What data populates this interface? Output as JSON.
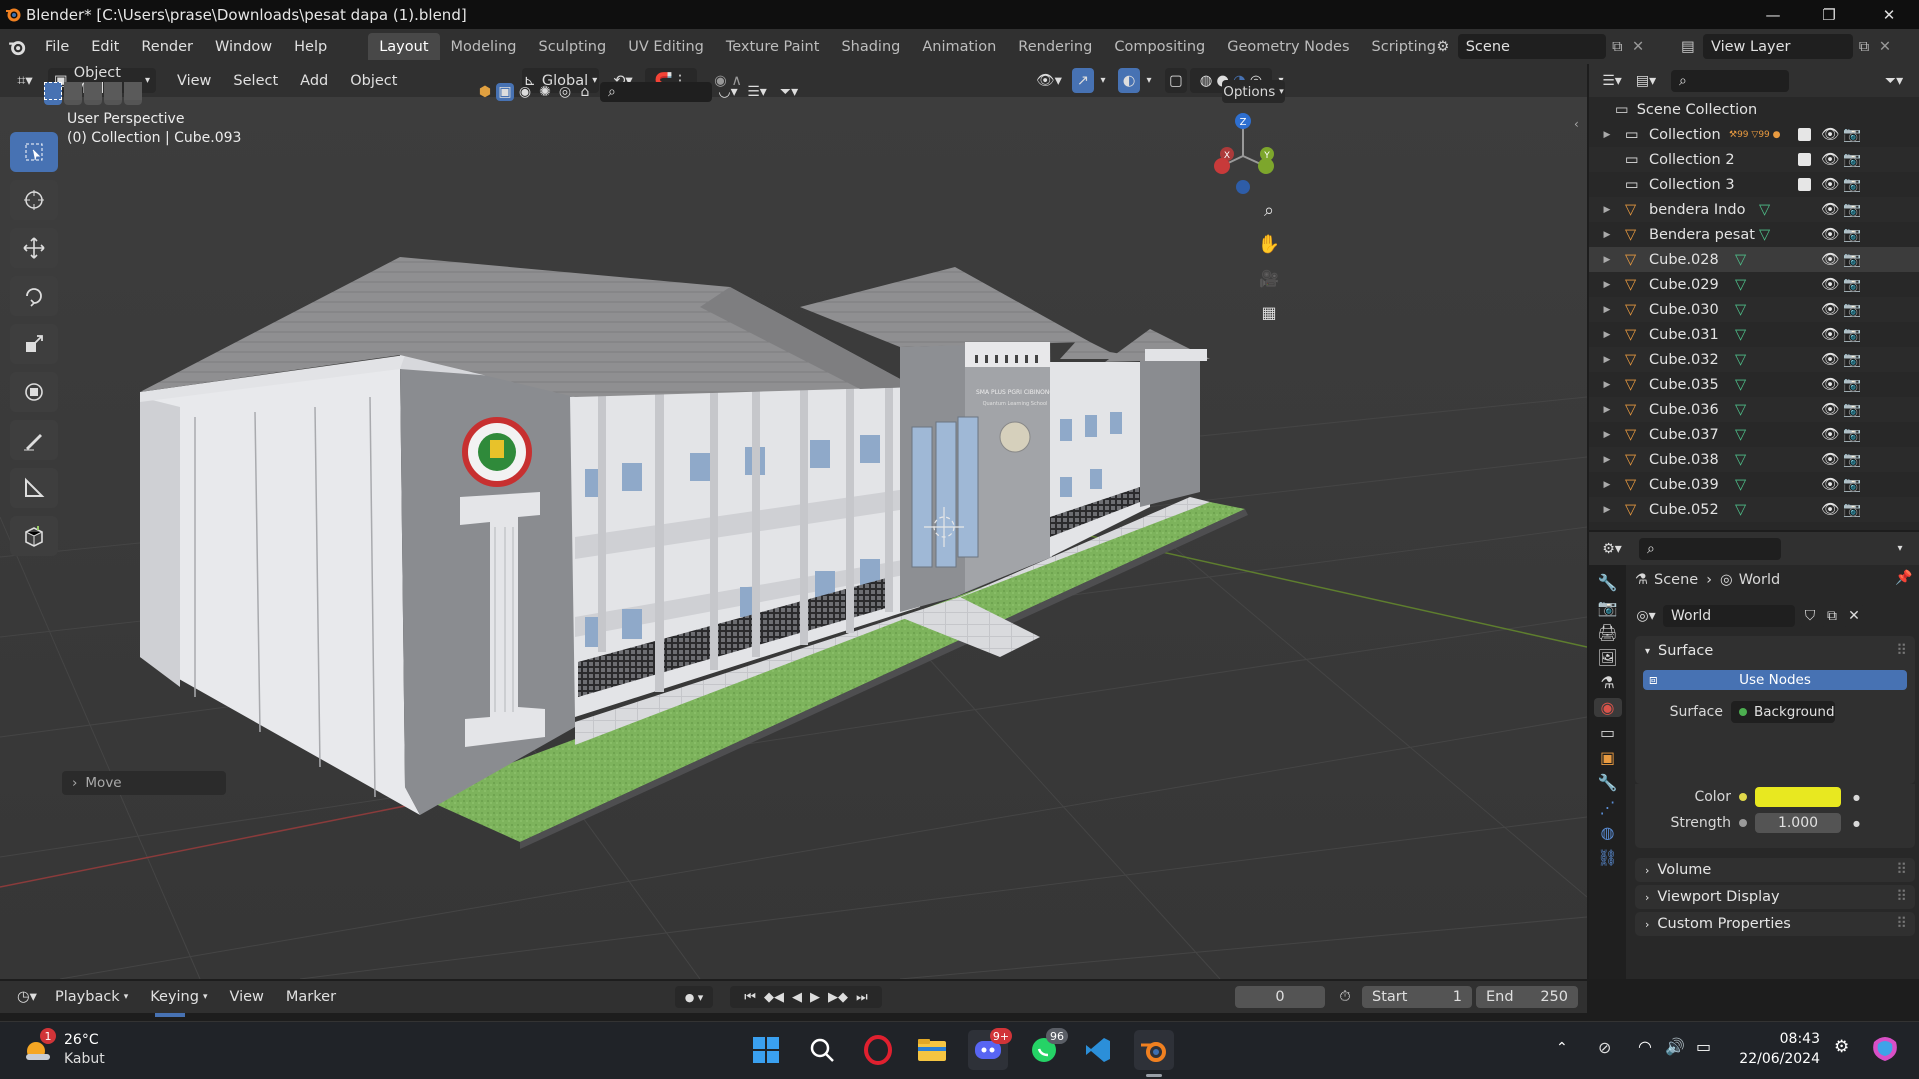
{
  "window": {
    "title": "Blender* [C:\\Users\\prase\\Downloads\\pesat dapa (1).blend]"
  },
  "menu": [
    "File",
    "Edit",
    "Render",
    "Window",
    "Help"
  ],
  "workspaces": [
    "Layout",
    "Modeling",
    "Sculpting",
    "UV Editing",
    "Texture Paint",
    "Shading",
    "Animation",
    "Rendering",
    "Compositing",
    "Geometry Nodes",
    "Scripting"
  ],
  "active_workspace": "Layout",
  "scene": {
    "name": "Scene",
    "view_layer": "View Layer"
  },
  "viewport_header": {
    "mode": "Object Mode",
    "menus": [
      "View",
      "Select",
      "Add",
      "Object"
    ],
    "transform_orientation": "Global",
    "options": "Options"
  },
  "viewport": {
    "perspective": "User Perspective",
    "collection_info": "(0) Collection | Cube.093",
    "last_op": "Move",
    "gizmo_axes": [
      "X",
      "Y",
      "Z"
    ]
  },
  "building": {
    "sign_line1": "SMA PLUS PGRI CIBINONG",
    "sign_line2": "Quantum Learning School"
  },
  "outliner": {
    "root": "Scene Collection",
    "collection_badges": [
      "99",
      "99"
    ],
    "items": [
      {
        "name": "Collection",
        "type": "collection"
      },
      {
        "name": "Collection 2",
        "type": "collection"
      },
      {
        "name": "Collection 3",
        "type": "collection"
      },
      {
        "name": "bendera Indo",
        "type": "mesh"
      },
      {
        "name": "Bendera pesat",
        "type": "mesh"
      },
      {
        "name": "Cube.028",
        "type": "mesh"
      },
      {
        "name": "Cube.029",
        "type": "mesh"
      },
      {
        "name": "Cube.030",
        "type": "mesh"
      },
      {
        "name": "Cube.031",
        "type": "mesh"
      },
      {
        "name": "Cube.032",
        "type": "mesh"
      },
      {
        "name": "Cube.035",
        "type": "mesh"
      },
      {
        "name": "Cube.036",
        "type": "mesh"
      },
      {
        "name": "Cube.037",
        "type": "mesh"
      },
      {
        "name": "Cube.038",
        "type": "mesh"
      },
      {
        "name": "Cube.039",
        "type": "mesh"
      },
      {
        "name": "Cube.052",
        "type": "mesh"
      }
    ]
  },
  "properties": {
    "breadcrumb": [
      "Scene",
      "World"
    ],
    "world_name": "World",
    "surface_panel": "Surface",
    "use_nodes": "Use Nodes",
    "surface_label": "Surface",
    "surface_value": "Background",
    "color_label": "Color",
    "color_value": "#e8e820",
    "strength_label": "Strength",
    "strength_value": "1.000",
    "panels": [
      "Volume",
      "Viewport Display",
      "Custom Properties"
    ]
  },
  "timeline": {
    "menus": [
      "Playback",
      "Keying",
      "View",
      "Marker"
    ],
    "current_frame": "0",
    "start_label": "Start",
    "start": "1",
    "end_label": "End",
    "end": "250"
  },
  "taskbar": {
    "weather_temp": "26°C",
    "weather_desc": "Kabut",
    "weather_badge": "1",
    "discord_badge": "9+",
    "whatsapp_badge": "96",
    "time": "08:43",
    "date": "22/06/2024"
  },
  "colors": {
    "accent": "#4772b3",
    "header": "#303030",
    "grass": "#7bb35a",
    "wall": "#d9dbe0"
  }
}
